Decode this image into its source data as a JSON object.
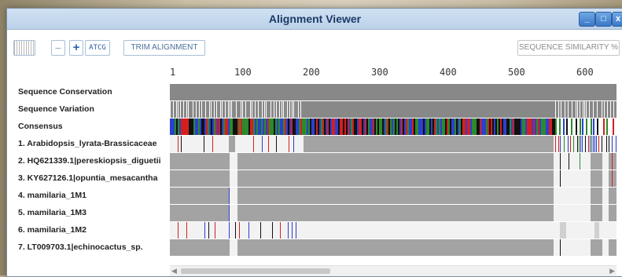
{
  "window": {
    "title": "Alignment Viewer",
    "controls": {
      "minimize": "_",
      "maximize": "□",
      "close": "x"
    }
  },
  "toolbar": {
    "minus_label": "−",
    "plus_label": "+",
    "atcg_label": "ATCG",
    "trim_label": "TRIM ALIGNMENT",
    "similarity_label": "SEQUENCE SIMILARITY %"
  },
  "ruler": {
    "ticks": [
      "1",
      "100",
      "200",
      "300",
      "400",
      "500",
      "600"
    ]
  },
  "tracks": [
    {
      "label": "Sequence Conservation"
    },
    {
      "label": "Sequence Variation"
    },
    {
      "label": "Consensus"
    }
  ],
  "sequences": [
    {
      "label": "1. Arabidopsis_lyrata-Brassicaceae"
    },
    {
      "label": "2. HQ621339.1|pereskiopsis_diguetii"
    },
    {
      "label": "3. KY627126.1|opuntia_mesacantha"
    },
    {
      "label": "4. mamilaria_1M1"
    },
    {
      "label": "5. mamilaria_1M3"
    },
    {
      "label": "6. mamilaria_1M2"
    },
    {
      "label": "7. LT009703.1|echinocactus_sp."
    }
  ],
  "colors": {
    "title_bar": "#bcd2ea",
    "track_gray": "#a3a3a3",
    "conservation_gray": "#888888",
    "base_A": "#2b8a2b",
    "base_C": "#2d3fd0",
    "base_G": "#111111",
    "base_T": "#d41f1f"
  }
}
